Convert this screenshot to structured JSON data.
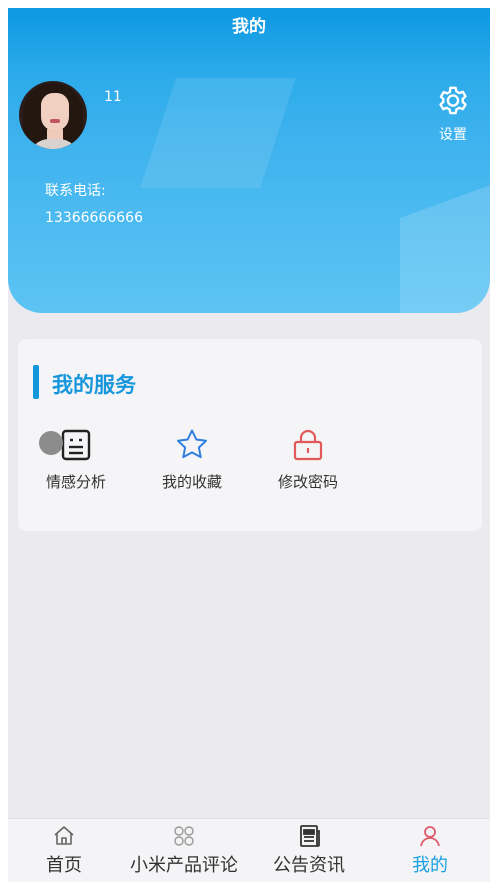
{
  "header": {
    "title": "我的",
    "username": "11",
    "settings_label": "设置",
    "phone_label": "联系电话:",
    "phone_value": "13366666666"
  },
  "services": {
    "title": "我的服务",
    "items": [
      {
        "label": "情感分析",
        "icon": "analysis-icon"
      },
      {
        "label": "我的收藏",
        "icon": "star-icon"
      },
      {
        "label": "修改密码",
        "icon": "lock-icon"
      }
    ]
  },
  "bottom_nav": {
    "items": [
      {
        "label": "首页",
        "icon": "home-icon",
        "active": false
      },
      {
        "label": "小米产品评论",
        "icon": "grid-icon",
        "active": false
      },
      {
        "label": "公告资讯",
        "icon": "news-icon",
        "active": false
      },
      {
        "label": "我的",
        "icon": "user-icon",
        "active": true
      }
    ]
  },
  "colors": {
    "accent": "#1aa0e2",
    "header_gradient_top": "#1aa3e6",
    "header_gradient_bottom": "#5cc4f3",
    "star_color": "#2f7fe0",
    "lock_color": "#e05a5a",
    "active_user_color": "#e05a6a"
  }
}
